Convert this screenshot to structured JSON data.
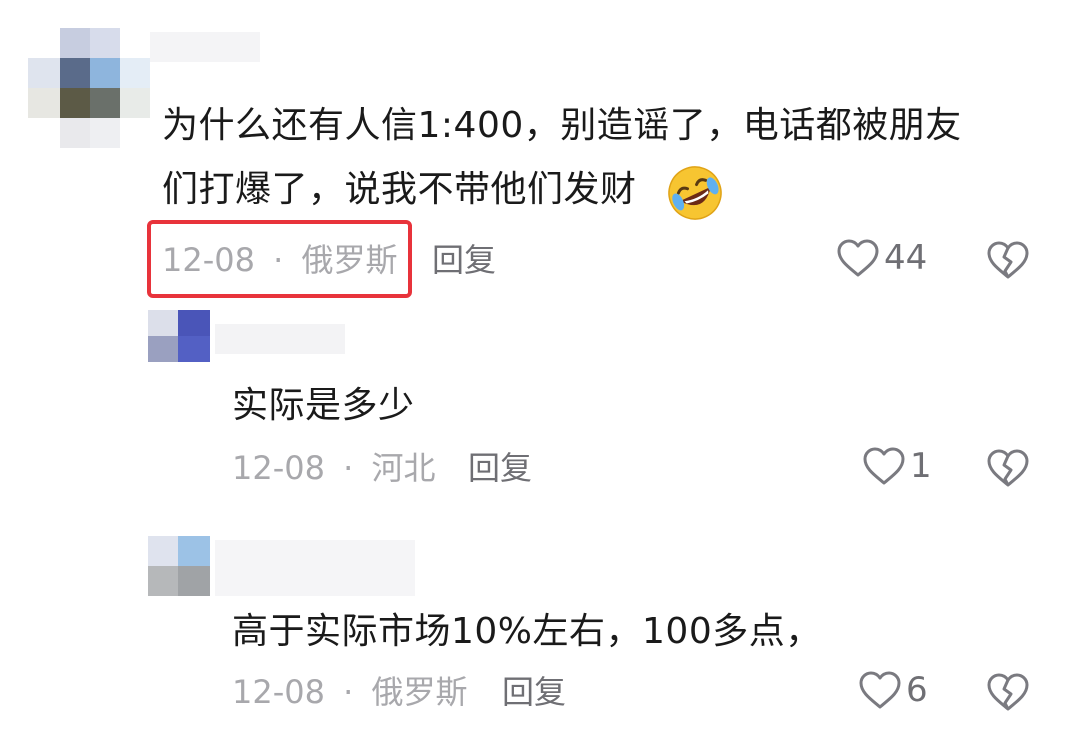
{
  "colors": {
    "highlight": "#e8333b",
    "meta_text": "#a8a8ac",
    "action_text": "#6f6f74",
    "body_text": "#1a1a1a"
  },
  "comments": [
    {
      "text_line1": "为什么还有人信1:400，别造谣了，电话都被朋友",
      "text_line2": "们打爆了，说我不带他们发财",
      "emoji": "rolling-on-floor-laughing-emoji",
      "date": "12-08",
      "separator": "·",
      "location": "俄罗斯",
      "reply_label": "回复",
      "likes": "44",
      "like_icon": "heart-outline-icon",
      "dislike_icon": "broken-heart-icon"
    },
    {
      "text": "实际是多少",
      "date": "12-08",
      "separator": "·",
      "location": "河北",
      "reply_label": "回复",
      "likes": "1",
      "like_icon": "heart-outline-icon",
      "dislike_icon": "broken-heart-icon"
    },
    {
      "text": "高于实际市场10%左右，100多点，",
      "date": "12-08",
      "separator": "·",
      "location": "俄罗斯",
      "reply_label": "回复",
      "likes": "6",
      "like_icon": "heart-outline-icon",
      "dislike_icon": "broken-heart-icon"
    }
  ]
}
